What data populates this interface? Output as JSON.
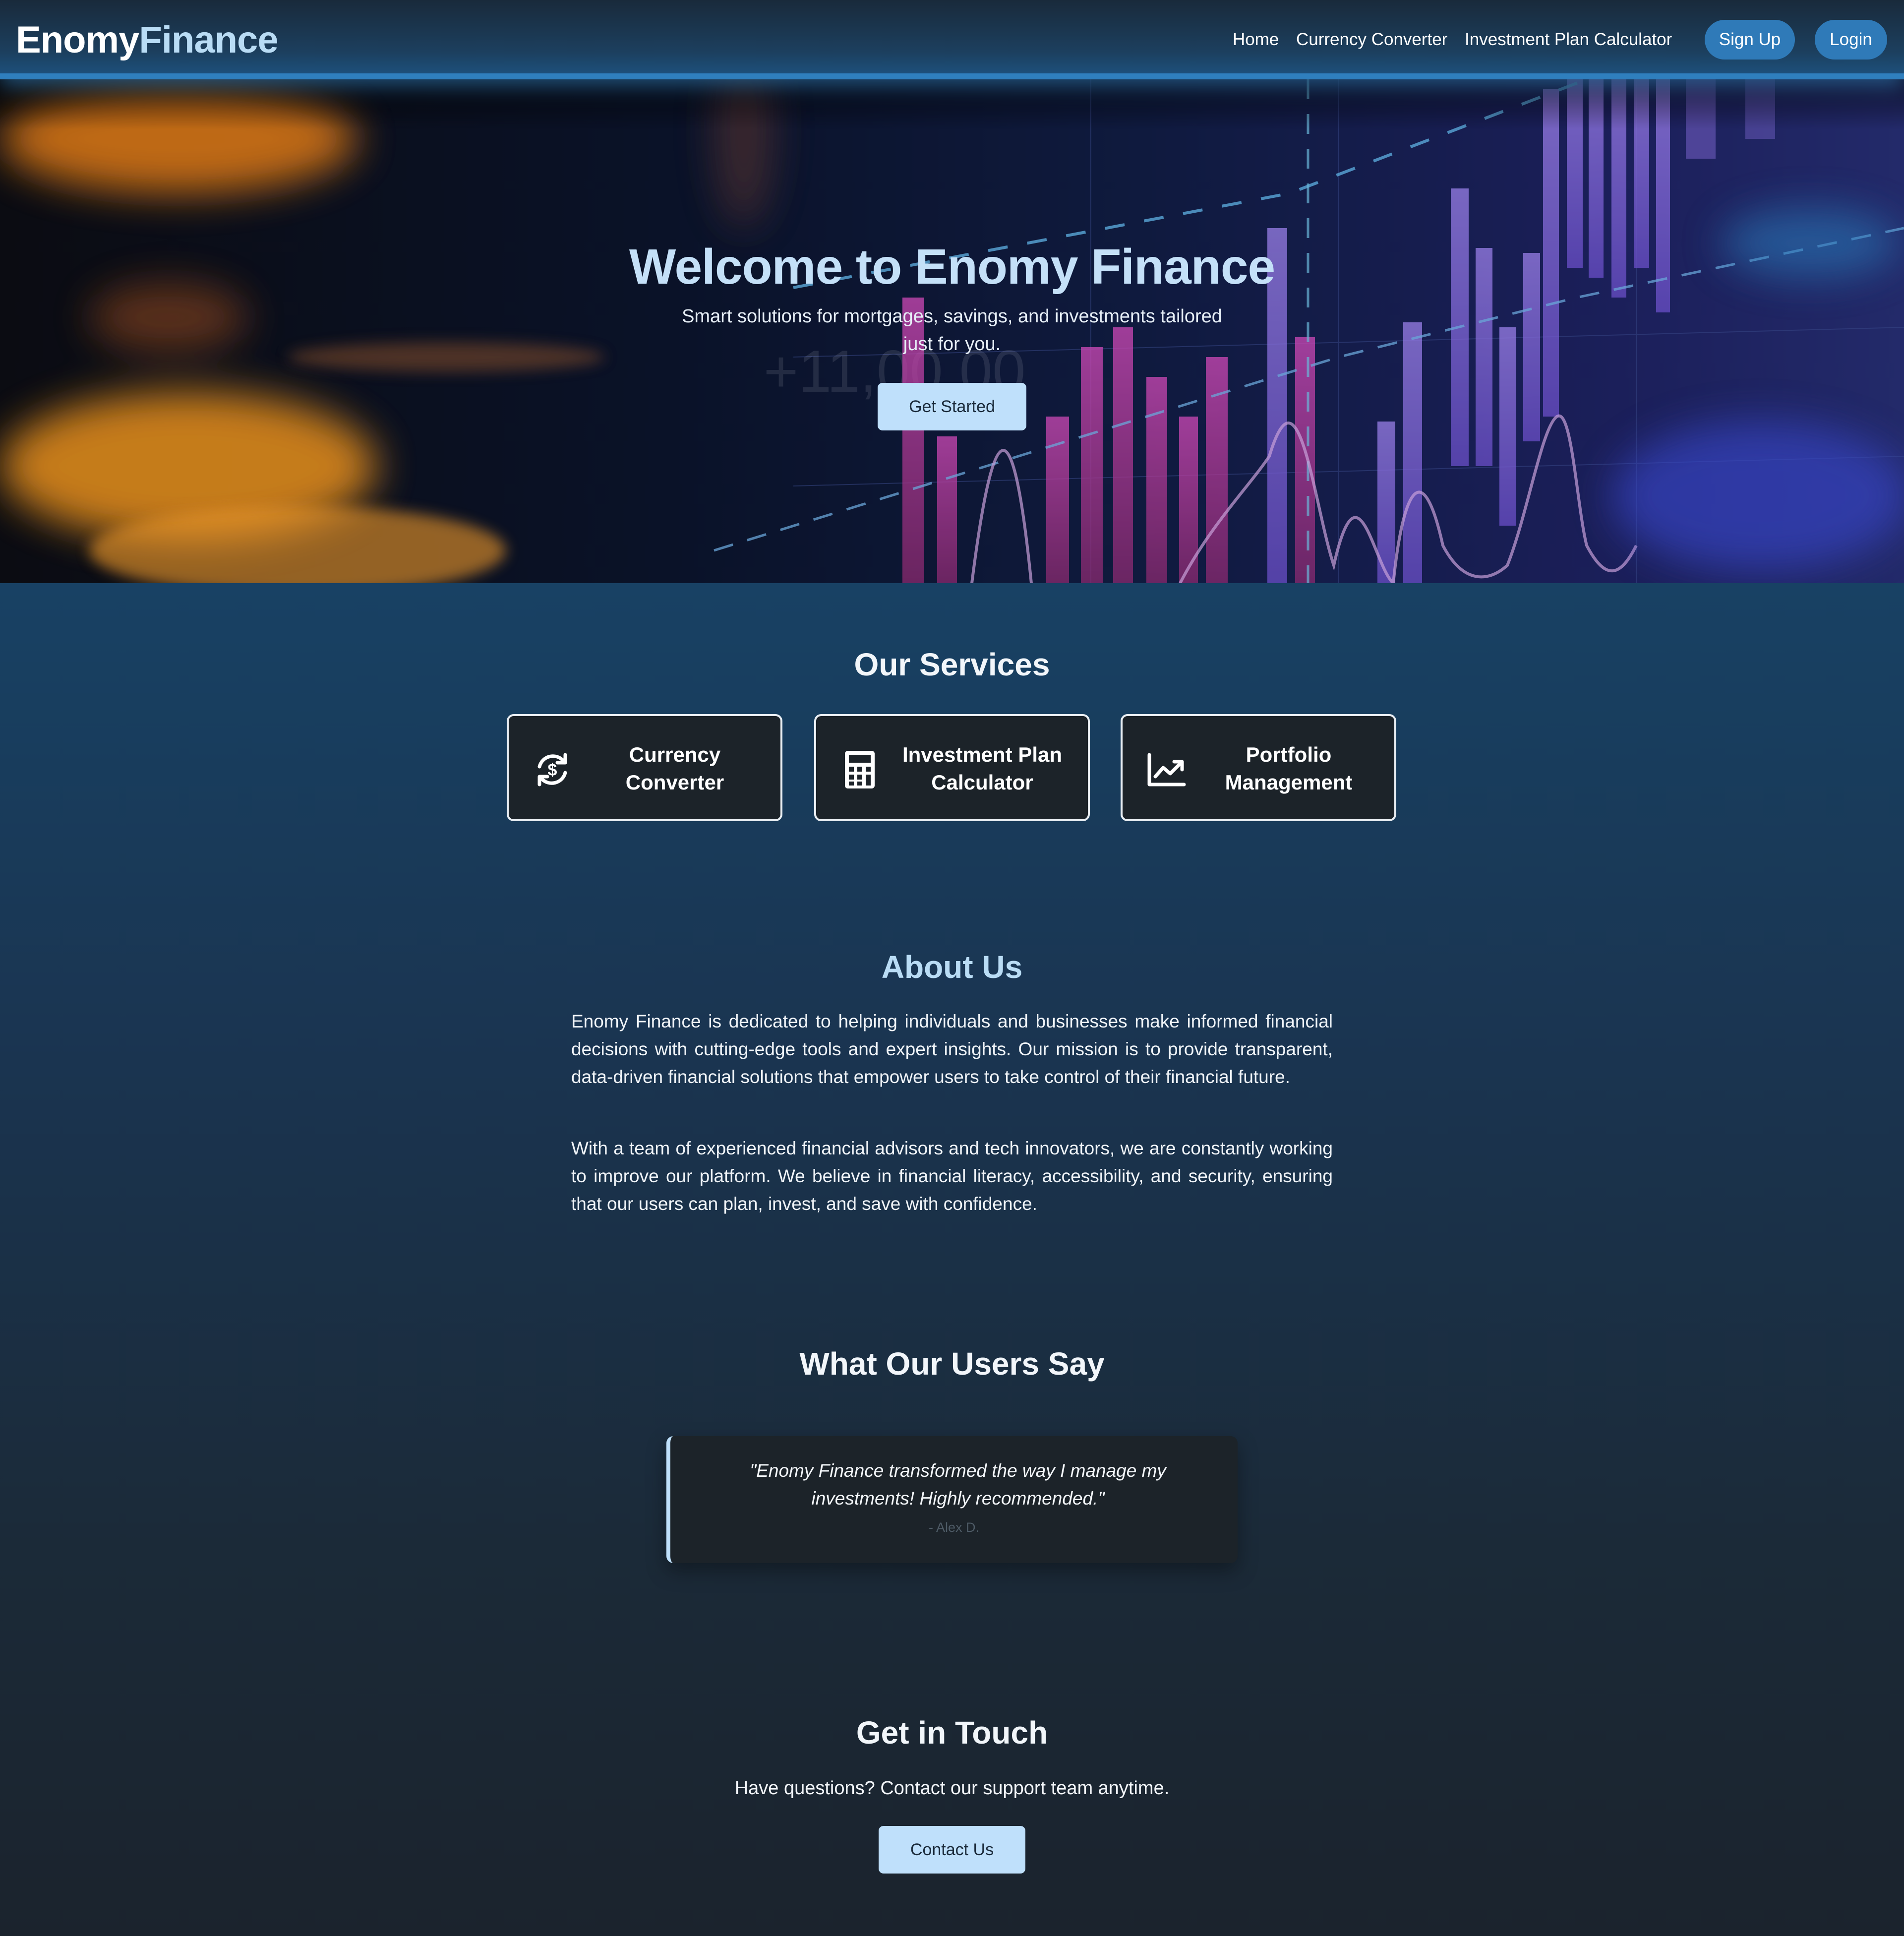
{
  "header": {
    "logo_part1": "Enomy",
    "logo_part2": "Finance",
    "nav": {
      "home": "Home",
      "currency_converter": "Currency Converter",
      "investment_plan_calculator": "Investment Plan Calculator"
    },
    "signup_label": "Sign Up",
    "login_label": "Login"
  },
  "hero": {
    "title": "Welcome to Enomy Finance",
    "subtitle": "Smart solutions for mortgages, savings, and investments tailored just for you.",
    "cta_label": "Get Started",
    "background_text": "+11,00.00"
  },
  "services": {
    "title": "Our Services",
    "items": [
      {
        "label": "Currency Converter",
        "icon": "currency-exchange-icon"
      },
      {
        "label": "Investment Plan Calculator",
        "icon": "calculator-icon"
      },
      {
        "label": "Portfolio Management",
        "icon": "chart-line-icon"
      }
    ]
  },
  "about": {
    "title": "About Us",
    "paragraphs": [
      "Enomy Finance is dedicated to helping individuals and businesses make informed financial decisions with cutting-edge tools and expert insights. Our mission is to provide transparent, data-driven financial solutions that empower users to take control of their financial future.",
      "With a team of experienced financial advisors and tech innovators, we are constantly working to improve our platform. We believe in financial literacy, accessibility, and security, ensuring that our users can plan, invest, and save with confidence."
    ]
  },
  "testimonials": {
    "title": "What Our Users Say",
    "items": [
      {
        "quote": "\"Enomy Finance transformed the way I manage my investments! Highly recommended.\"",
        "author": "- Alex D."
      }
    ]
  },
  "contact": {
    "title": "Get in Touch",
    "text": "Have questions? Contact our support team anytime.",
    "button_label": "Contact Us"
  },
  "colors": {
    "accent": "#2f7ab8",
    "light_accent": "#bfe0fb",
    "card_bg": "#1c2329",
    "heading_blue": "#b9dcf5"
  }
}
